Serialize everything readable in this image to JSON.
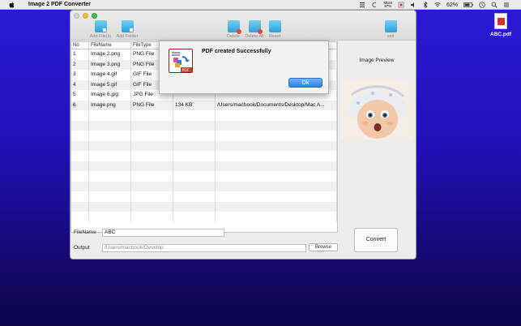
{
  "menubar": {
    "app_name": "Image 2 PDF Converter",
    "battery": "62%",
    "cpu_label": "MEM",
    "cpu_value": "97%"
  },
  "desktop_file": {
    "name": "ABC.pdf"
  },
  "toolbar": {
    "add_files": "Add File(s)",
    "add_folder": "Add Folder",
    "delete": "Delete",
    "delete_all": "Delete All",
    "reset": "Reset",
    "exit": "exit"
  },
  "table": {
    "headers": [
      "No",
      "FileName",
      "FileType",
      "",
      ""
    ],
    "rows": [
      {
        "no": "1",
        "name": "Image 2.png",
        "type": "PNG File",
        "size": "",
        "path": ""
      },
      {
        "no": "2",
        "name": "Image 3.png",
        "type": "PNG File",
        "size": "",
        "path": ""
      },
      {
        "no": "3",
        "name": "Image 4.gif",
        "type": "GIF File",
        "size": "",
        "path": ""
      },
      {
        "no": "4",
        "name": "Image 5.gif",
        "type": "GIF File",
        "size": "",
        "path": ""
      },
      {
        "no": "5",
        "name": "Image 6.jpg",
        "type": "JPG File",
        "size": "",
        "path": ""
      },
      {
        "no": "6",
        "name": "Image.png",
        "type": "PNG File",
        "size": "134 KB",
        "path": "/Users/macbook/Documents/Desktop/Mac A..."
      }
    ]
  },
  "preview": {
    "title": "Image Preview"
  },
  "form": {
    "filename_label": "FileName",
    "filename_value": "ABC",
    "output_label": "Output",
    "output_value": "/Users/macbook/Desktop",
    "browse_label": "Browse",
    "convert_label": "Convert"
  },
  "alert": {
    "title": "PDF created Successfully",
    "ok_label": "Ok"
  },
  "colors": {
    "desktop_top": "#2a1bd6",
    "desktop_bottom": "#0c0648",
    "ok_button": "#2a7fe6",
    "toolbar_icon": "#2fa0d8"
  }
}
